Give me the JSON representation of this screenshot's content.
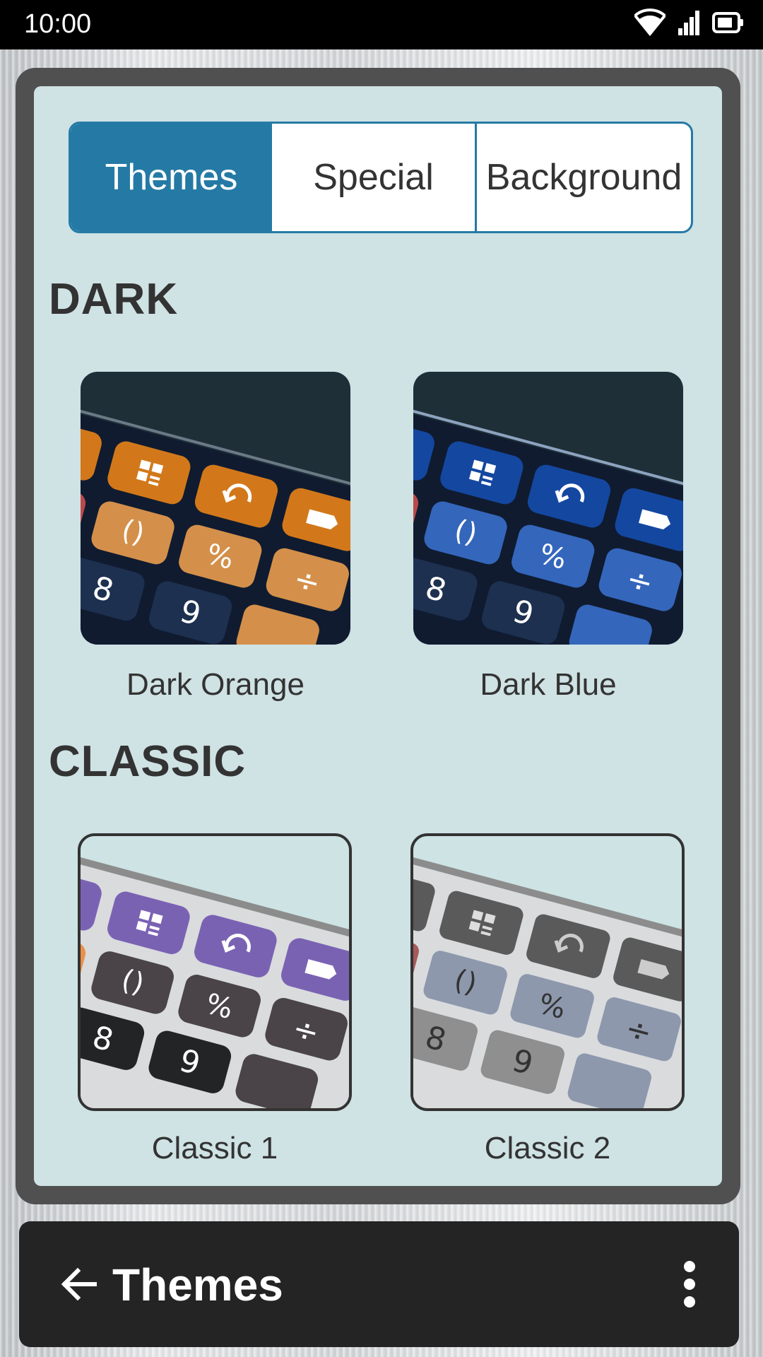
{
  "status_bar": {
    "time": "10:00",
    "icons": [
      "wifi-icon",
      "signal-icon",
      "battery-icon"
    ]
  },
  "tabs": [
    {
      "label": "Themes",
      "selected": true
    },
    {
      "label": "Special",
      "selected": false
    },
    {
      "label": "Background",
      "selected": false
    }
  ],
  "sections": [
    {
      "title": "DARK",
      "themes": [
        {
          "name": "Dark Orange",
          "accent": "#d2781a",
          "key_color": "#d4904a"
        },
        {
          "name": "Dark Blue",
          "accent": "#1447a0",
          "key_color": "#3466bb"
        }
      ]
    },
    {
      "title": "CLASSIC",
      "themes": [
        {
          "name": "Classic 1",
          "accent": "#7a62b3"
        },
        {
          "name": "Classic 2",
          "accent": "#5a5a5a"
        }
      ]
    }
  ],
  "preview_keys": [
    "8",
    "9",
    "%",
    "()",
    "÷"
  ],
  "bottom_bar": {
    "title": "Themes",
    "back_icon": "arrow-left-icon",
    "menu_icon": "more-vertical-icon"
  },
  "colors": {
    "primary": "#257aa5",
    "panel_bg": "#cfe2e4",
    "bar_bg": "#242424"
  }
}
